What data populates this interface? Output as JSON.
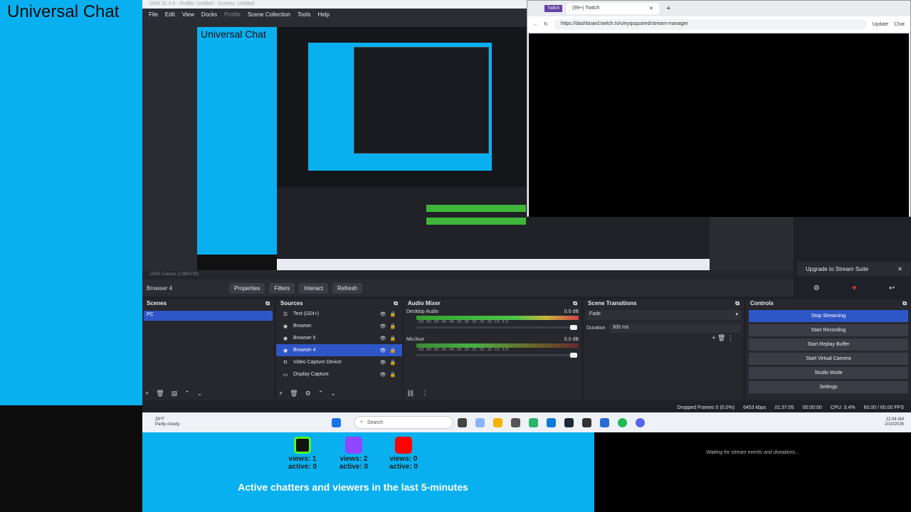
{
  "overlay": {
    "title": "Universal Chat"
  },
  "obs": {
    "title": "OBS 32.0.4 - Profile: Untitled - Scenes: Untitled",
    "menu": [
      "File",
      "Edit",
      "View",
      "Docks",
      "Profile",
      "Scene Collection",
      "Tools",
      "Help"
    ],
    "preview_title": "Universal Chat",
    "status_small": "100%   Canvas (1280x720)",
    "context": {
      "source": "Browser 4",
      "properties": "Properties",
      "filters": "Filters",
      "interact": "Interact",
      "refresh": "Refresh"
    },
    "upgrade": "Upgrade to Stream Suite",
    "docks": {
      "scenes": "Scenes",
      "sources": "Sources",
      "mixer": "Audio Mixer",
      "transitions": "Scene Transitions",
      "controls": "Controls"
    },
    "scenes": [
      "PC"
    ],
    "sources": [
      "Text (GDI+)",
      "Browser",
      "Browser 5",
      "Browser 4",
      "Video Capture Device",
      "Display Capture"
    ],
    "mixer": [
      {
        "name": "Desktop Audio",
        "db": "0.0 dB"
      },
      {
        "name": "Mic/Aux",
        "db": "0.0 dB"
      }
    ],
    "mixer_scale": "-60 -55 -50 -45 -40 -35 -30 -25 -20 -15 -10 -5 0",
    "transitions": {
      "type": "Fade",
      "duration_label": "Duration",
      "duration": "300 ms"
    },
    "controls": [
      "Stop Streaming",
      "Start Recording",
      "Start Replay Buffer",
      "Start Virtual Camera",
      "Studio Mode",
      "Settings"
    ],
    "status": {
      "dropped": "Dropped Frames 0 (0.0%)",
      "bitrate": "6453 kbps",
      "live": "01:37:05",
      "rec": "00:00:00",
      "cpu": "CPU: 3.4%",
      "fps": "60.00 / 60.00 FPS"
    }
  },
  "taskbar": {
    "weather_temp": "28°F",
    "weather_desc": "Partly cloudy",
    "search": "Search",
    "time": "12:34 AM",
    "date": "2/10/2026"
  },
  "browser": {
    "tab_label": "(99+) Twitch",
    "tab2": "Twitch",
    "url": "https://dashboard.twitch.tv/u/eyqsquared/stream-manager",
    "update": "Update",
    "chat": "Chat"
  },
  "stats": [
    {
      "platform": "kick",
      "views": "views: 1",
      "active": "active: 0",
      "color": "#53fc18"
    },
    {
      "platform": "twitch",
      "views": "views: 2",
      "active": "active: 0",
      "color": "#9146ff"
    },
    {
      "platform": "youtube",
      "views": "views: 0",
      "active": "active: 0",
      "color": "#ff0000"
    }
  ],
  "stats_caption": "Active chatters and viewers in the last 5-minutes",
  "waiting": "Waiting for stream events and donations..."
}
